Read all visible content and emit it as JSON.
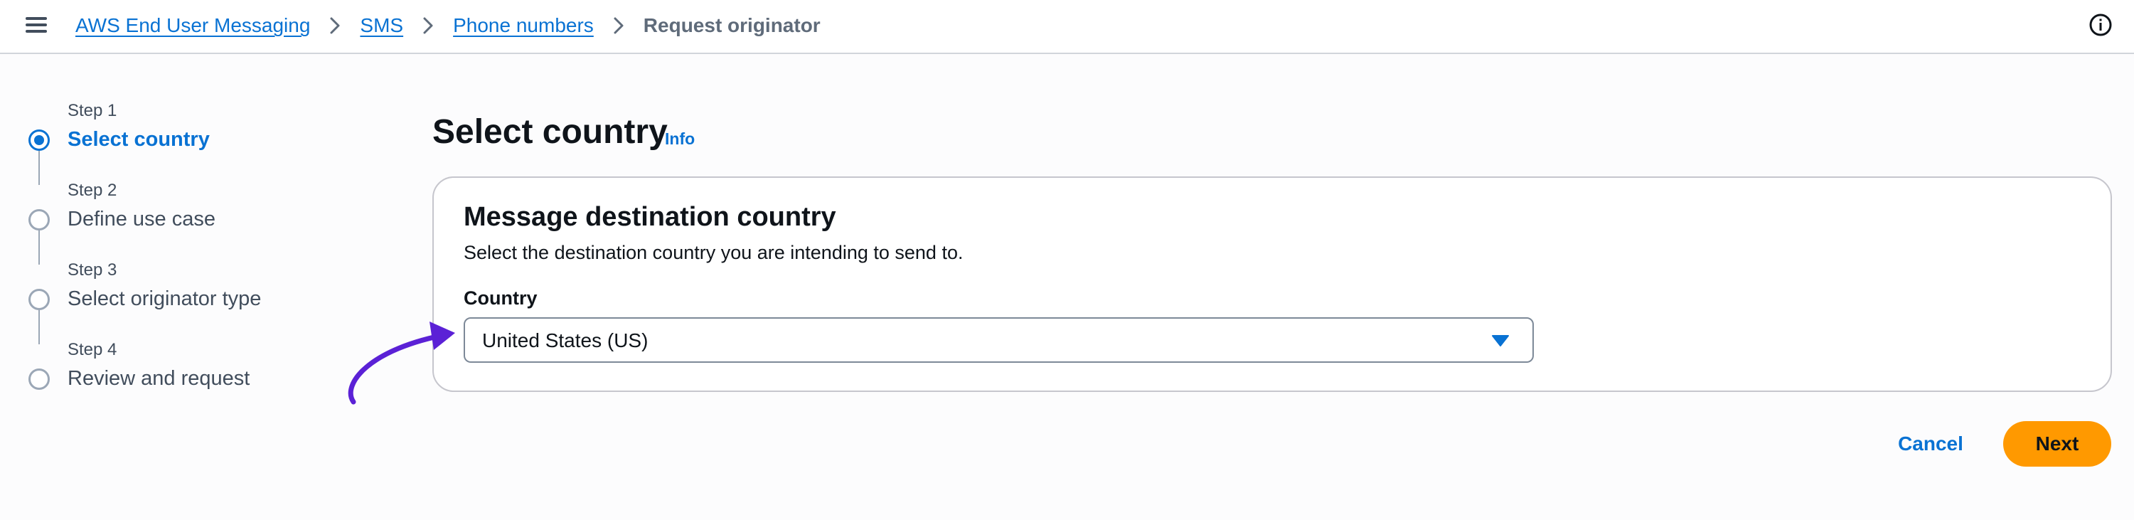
{
  "header": {
    "menu_icon": "hamburger-menu-icon",
    "breadcrumb": [
      {
        "label": "AWS End User Messaging"
      },
      {
        "label": "SMS"
      },
      {
        "label": "Phone numbers"
      }
    ],
    "current": "Request originator",
    "info_icon": "info-circle-icon"
  },
  "steps": [
    {
      "number": "Step 1",
      "label": "Select country",
      "active": true
    },
    {
      "number": "Step 2",
      "label": "Define use case",
      "active": false
    },
    {
      "number": "Step 3",
      "label": "Select originator type",
      "active": false
    },
    {
      "number": "Step 4",
      "label": "Review and request",
      "active": false
    }
  ],
  "main": {
    "title": "Select country",
    "info_link": "Info",
    "panel": {
      "title": "Message destination country",
      "description": "Select the destination country you are intending to send to.",
      "field_label": "Country",
      "field_value": "United States (US)"
    }
  },
  "actions": {
    "cancel": "Cancel",
    "next": "Next"
  },
  "colors": {
    "accent": "#0972d3",
    "primary_button": "#ff9900",
    "annotation_arrow": "#5b21d6"
  }
}
